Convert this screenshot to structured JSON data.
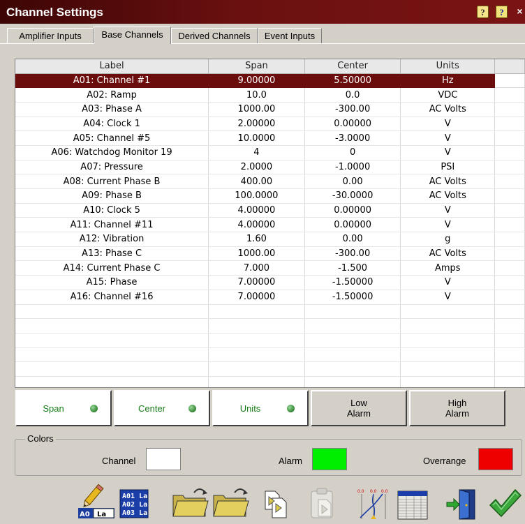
{
  "window": {
    "title": "Channel Settings",
    "help_icon_1": "?",
    "help_icon_2": "?",
    "close": "×"
  },
  "tabs": [
    {
      "label": "Amplifier Inputs",
      "active": false
    },
    {
      "label": "Base Channels",
      "active": true
    },
    {
      "label": "Derived Channels",
      "active": false
    },
    {
      "label": "Event Inputs",
      "active": false
    }
  ],
  "table": {
    "headers": [
      "Label",
      "Span",
      "Center",
      "Units"
    ],
    "rows": [
      [
        "A01: Channel #1",
        "9.00000",
        "5.50000",
        "Hz"
      ],
      [
        "A02: Ramp",
        "10.0",
        "0.0",
        "VDC"
      ],
      [
        "A03: Phase A",
        "1000.00",
        "-300.00",
        "AC Volts"
      ],
      [
        "A04: Clock 1",
        "2.00000",
        "0.00000",
        "V"
      ],
      [
        "A05: Channel #5",
        "10.0000",
        "-3.0000",
        "V"
      ],
      [
        "A06: Watchdog Monitor 19",
        "4",
        "0",
        "V"
      ],
      [
        "A07: Pressure",
        "2.0000",
        "-1.0000",
        "PSI"
      ],
      [
        "A08: Current Phase B",
        "400.00",
        "0.00",
        "AC Volts"
      ],
      [
        "A09: Phase B",
        "100.0000",
        "-30.0000",
        "AC Volts"
      ],
      [
        "A10: Clock 5",
        "4.00000",
        "0.00000",
        "V"
      ],
      [
        "A11: Channel #11",
        "4.00000",
        "0.00000",
        "V"
      ],
      [
        "A12: Vibration",
        "1.60",
        "0.00",
        "g"
      ],
      [
        "A13: Phase C",
        "1000.00",
        "-300.00",
        "AC Volts"
      ],
      [
        "A14: Current Phase C",
        "7.000",
        "-1.500",
        "Amps"
      ],
      [
        "A15: Phase",
        "7.00000",
        "-1.50000",
        "V"
      ],
      [
        "A16: Channel #16",
        "7.00000",
        "-1.50000",
        "V"
      ]
    ],
    "empty_rows": 6,
    "selected_row": 0
  },
  "sort_buttons": {
    "span": "Span",
    "center": "Center",
    "units": "Units",
    "low_alarm_line1": "Low",
    "low_alarm_line2": "Alarm",
    "high_alarm_line1": "High",
    "high_alarm_line2": "Alarm"
  },
  "colors": {
    "legend": "Colors",
    "channel_label": "Channel",
    "alarm_label": "Alarm",
    "overrange_label": "Overrange",
    "channel_color": "#ffffff",
    "alarm_color": "#00ee00",
    "overrange_color": "#ee0000"
  },
  "toolbar": {
    "label_tool_text": "La",
    "label_tool_prefix": "A0",
    "label_list_lines": [
      "A01 La",
      "A02 La",
      "A03 La"
    ],
    "chart_ticks": [
      "0.0",
      "0.0",
      "0.0"
    ],
    "icons": [
      "edit-label-icon",
      "label-list-icon",
      "open-folder-icon",
      "open-folder-2-icon",
      "copy-settings-icon",
      "paste-settings-icon",
      "span-center-chart-icon",
      "channel-table-icon",
      "exit-door-icon",
      "ok-check-icon"
    ]
  }
}
